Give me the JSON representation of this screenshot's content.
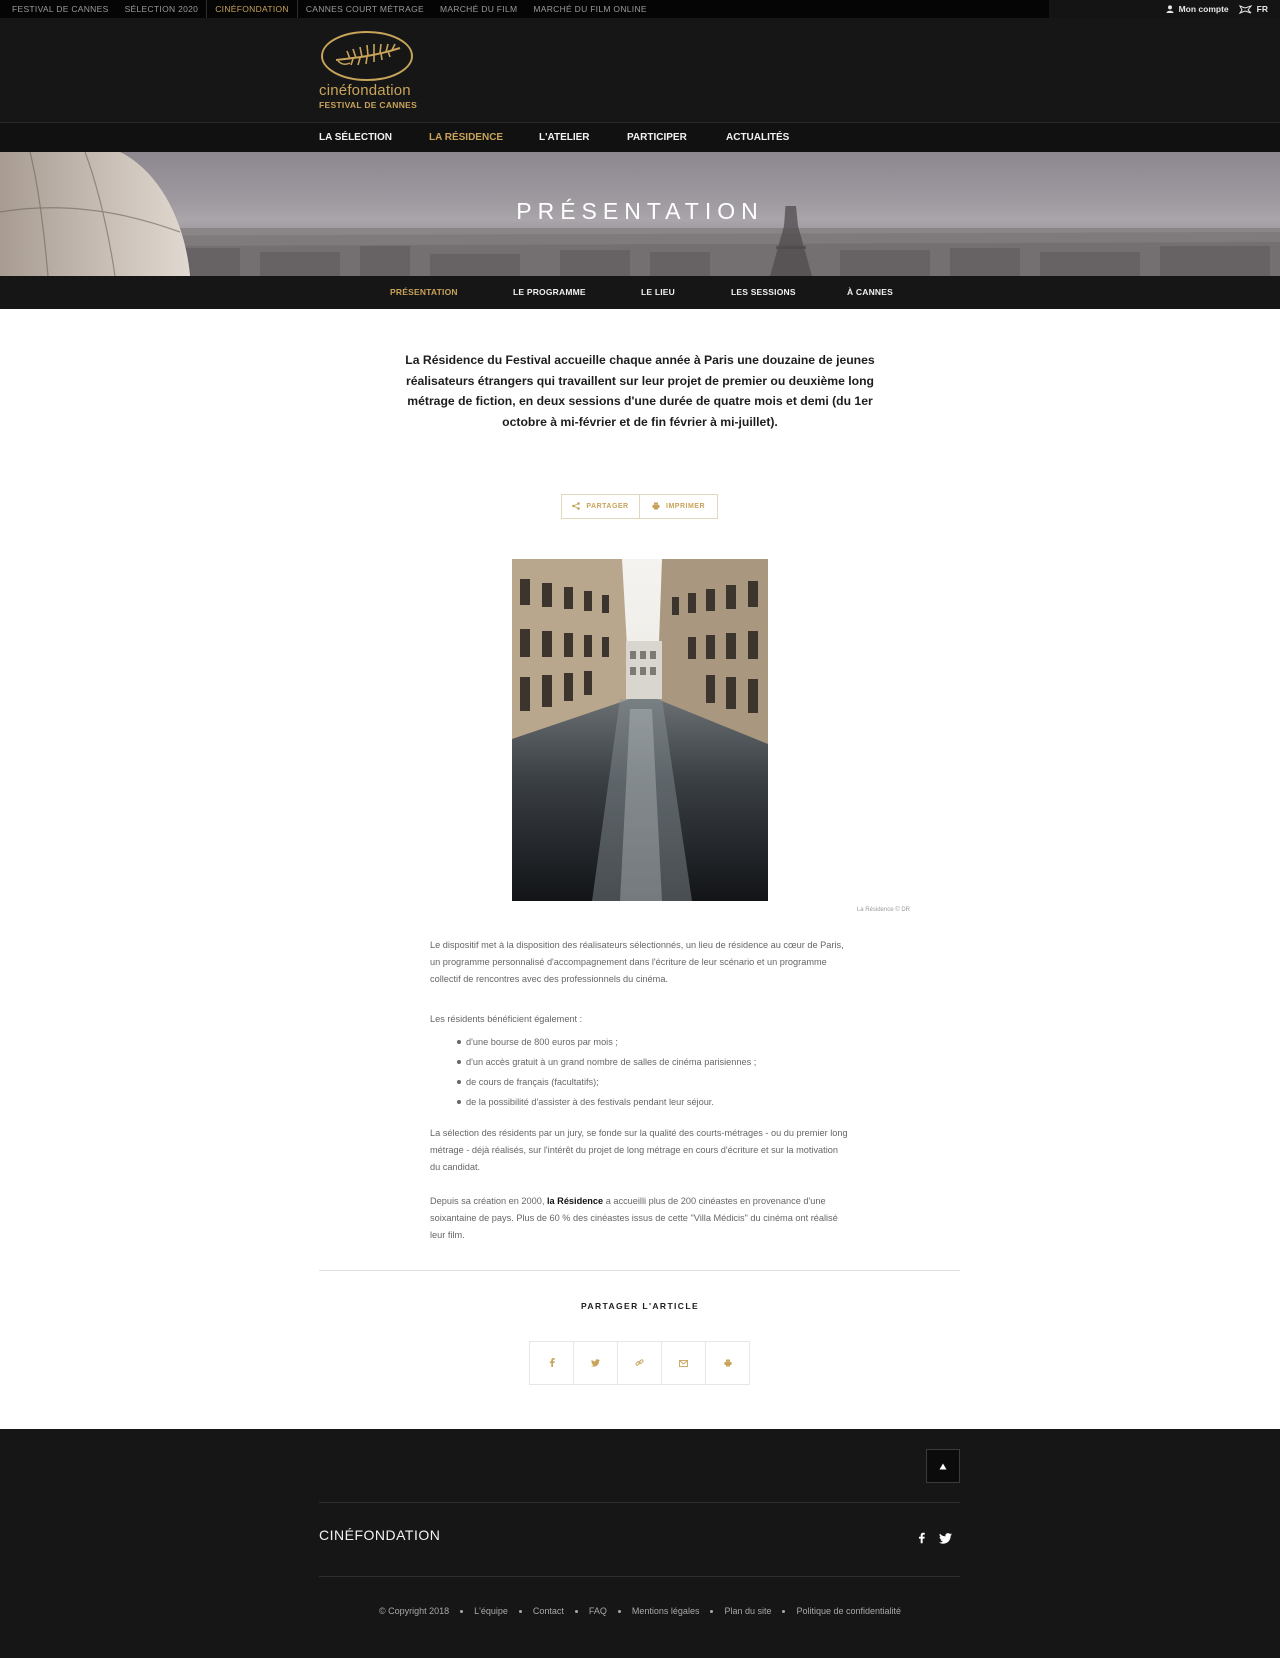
{
  "topbar": {
    "links": [
      {
        "label": "FESTIVAL DE CANNES"
      },
      {
        "label": "SÉLECTION 2020"
      },
      {
        "label": "CINÉFONDATION"
      },
      {
        "label": "CANNES COURT MÉTRAGE"
      },
      {
        "label": "MARCHÉ DU FILM"
      },
      {
        "label": "MARCHÉ DU FILM ONLINE"
      }
    ],
    "account_label": "Mon compte",
    "language": "FR"
  },
  "logo": {
    "name": "cinéfondation",
    "subtitle": "FESTIVAL DE CANNES"
  },
  "mainnav": {
    "items": [
      {
        "label": "LA SÉLECTION"
      },
      {
        "label": "LA RÉSIDENCE"
      },
      {
        "label": "L'ATELIER"
      },
      {
        "label": "PARTICIPER"
      },
      {
        "label": "ACTUALITÉS"
      }
    ]
  },
  "hero": {
    "title": "PRÉSENTATION"
  },
  "subnav": {
    "items": [
      {
        "label": "PRÉSENTATION"
      },
      {
        "label": "LE PROGRAMME"
      },
      {
        "label": "LE LIEU"
      },
      {
        "label": "LES SESSIONS"
      },
      {
        "label": "À CANNES"
      }
    ]
  },
  "article": {
    "lead": "La Résidence du Festival accueille chaque année à Paris une douzaine de jeunes réalisateurs étrangers qui travaillent sur leur projet de premier ou deuxième long métrage de fiction, en deux sessions d'une durée de quatre mois et demi (du 1er octobre à mi-février et de fin février à mi-juillet).",
    "share_label": "PARTAGER",
    "print_label": "IMPRIMER",
    "photo_caption": "La Résidence © DR",
    "p1": "Le dispositif met à la disposition des réalisateurs sélectionnés, un lieu de résidence au cœur de Paris, un programme personnalisé d'accompagnement dans l'écriture de leur scénario et un programme collectif de rencontres avec des professionnels du cinéma.",
    "p2": "Les résidents bénéficient également :",
    "list": [
      "d'une bourse de 800 euros par mois ;",
      "d'un accès gratuit à un grand nombre de salles de cinéma parisiennes ;",
      "de cours de français (facultatifs);",
      "de la possibilité d'assister à des festivals pendant leur séjour."
    ],
    "p3": "La sélection des résidents par un jury, se fonde sur la qualité des courts-métrages - ou du premier long métrage - déjà réalisés, sur l'intérêt du projet de long métrage en cours d'écriture et sur la motivation du candidat.",
    "p4_before": "Depuis sa création en 2000, ",
    "p4_strong": "la Résidence",
    "p4_after": " a accueilli plus de 200 cinéastes en provenance d'une soixantaine de pays. Plus de 60 % des cinéastes issus de cette \"Villa Médicis\" du cinéma ont réalisé leur film.",
    "share_title": "PARTAGER L'ARTICLE"
  },
  "footer": {
    "brand": "CINÉFONDATION",
    "links": [
      {
        "label": "© Copyright 2018"
      },
      {
        "label": "L'équipe"
      },
      {
        "label": "Contact"
      },
      {
        "label": "FAQ"
      },
      {
        "label": "Mentions légales"
      },
      {
        "label": "Plan du site"
      },
      {
        "label": "Politique de confidentialité"
      }
    ]
  },
  "colors": {
    "accent_gold": "#c8a35a",
    "dark_bg": "#161616",
    "topbar_bg": "#050505"
  },
  "icons": {
    "user": "user-icon",
    "flag": "flag-icon",
    "share": "share-icon",
    "print": "print-icon",
    "facebook": "facebook-icon",
    "twitter": "twitter-icon",
    "link": "link-icon",
    "mail": "mail-icon",
    "to_top": "arrow-up-icon"
  }
}
